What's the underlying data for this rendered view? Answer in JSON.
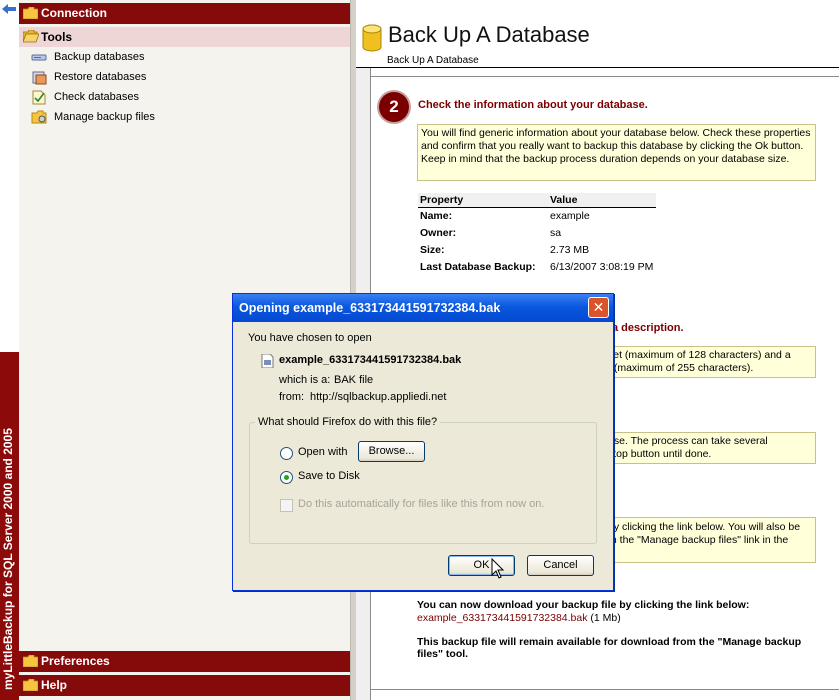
{
  "brand": {
    "vertical_text": "myLittleBackup for SQL Server 2000 and 2005"
  },
  "nav": {
    "sections": {
      "connection": "Connection",
      "tools": "Tools",
      "preferences": "Preferences",
      "help": "Help"
    },
    "items": [
      {
        "label": "Backup databases",
        "icon": "backup-icon"
      },
      {
        "label": "Restore databases",
        "icon": "restore-icon"
      },
      {
        "label": "Check databases",
        "icon": "check-icon"
      },
      {
        "label": "Manage backup files",
        "icon": "manage-files-icon"
      }
    ]
  },
  "content": {
    "title": "Back Up A Database",
    "subtitle": "Back Up A Database",
    "step2": {
      "number": "2",
      "heading": "Check the information about your database.",
      "note": "You will find generic information about your database below. Check these properties and confirm that you really want to backup this database by clicking the Ok button. Keep in mind that the backup process duration depends on your database size."
    },
    "table": {
      "headers": [
        "Property",
        "Value"
      ],
      "rows": [
        {
          "property": "Name:",
          "value": "example"
        },
        {
          "property": "Owner:",
          "value": "sa"
        },
        {
          "property": "Size:",
          "value": "2.73 MB"
        },
        {
          "property": "Last Database Backup:",
          "value": "6/13/2007 3:08:19 PM"
        }
      ]
    },
    "step3_heading_fragment": "a description.",
    "note3_fragment": "set (maximum of 128 characters) and a\nt (maximum of 255 characters).",
    "note4_fragment": "ase. The process can take several\nstop button until done.",
    "note5_fragment": "by clicking the link below. You will also be\nm the \"Manage backup files\" link in the",
    "download_heading": "You can now download your backup file by clicking the link below:",
    "download_link": "example_633173441591732384.bak",
    "download_size": " (1 Mb)",
    "availability": "This backup file will remain available for download from the \"Manage backup files\" tool."
  },
  "dialog": {
    "title": "Opening example_633173441591732384.bak",
    "close_glyph": "✕",
    "chosen_to_open": "You have chosen to open",
    "filename": "example_633173441591732384.bak",
    "which_is_label": "which is a:",
    "which_is_value": "BAK file",
    "from_label": "from:",
    "from_value": "http://sqlbackup.appliedi.net",
    "question": "What should Firefox do with this file?",
    "open_with": "Open with",
    "browse": "Browse...",
    "save_to_disk": "Save to Disk",
    "auto": "Do this automatically for files like this from now on.",
    "ok": "OK",
    "cancel": "Cancel",
    "selected_option": "save_to_disk"
  }
}
